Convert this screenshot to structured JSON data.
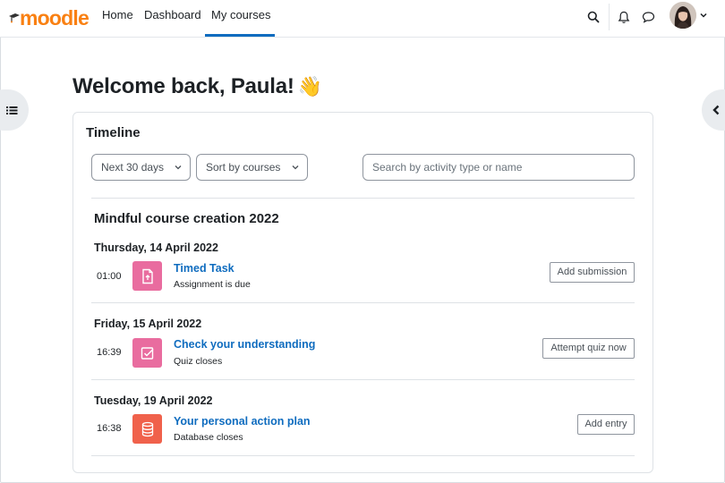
{
  "brand": {
    "logo_text": "moodle",
    "accent": "#f98012"
  },
  "nav": {
    "links": [
      {
        "label": "Home"
      },
      {
        "label": "Dashboard"
      },
      {
        "label": "My courses"
      }
    ],
    "active_color": "#0f6cbf",
    "icons": [
      "search-icon",
      "bell-icon",
      "chat-icon"
    ]
  },
  "welcome": {
    "text": "Welcome back, Paula!",
    "emoji": "👋"
  },
  "timeline": {
    "title": "Timeline",
    "filter_label": "Next 30 days",
    "sort_label": "Sort by courses",
    "search_placeholder": "Search by activity type or name",
    "course": "Mindful course creation 2022",
    "groups": [
      {
        "date": "Thursday, 14 April 2022",
        "time": "01:00",
        "name": "Timed Task",
        "sub": "Assignment is due",
        "action": "Add submission",
        "icon": "assignment-icon",
        "icon_color": "#e96c9f"
      },
      {
        "date": "Friday, 15 April 2022",
        "time": "16:39",
        "name": "Check your understanding",
        "sub": "Quiz closes",
        "action": "Attempt quiz now",
        "icon": "quiz-icon",
        "icon_color": "#e96c9f"
      },
      {
        "date": "Tuesday, 19 April 2022",
        "time": "16:38",
        "name": "Your personal action plan",
        "sub": "Database closes",
        "action": "Add entry",
        "icon": "database-icon",
        "icon_color": "#f0614b"
      }
    ]
  }
}
